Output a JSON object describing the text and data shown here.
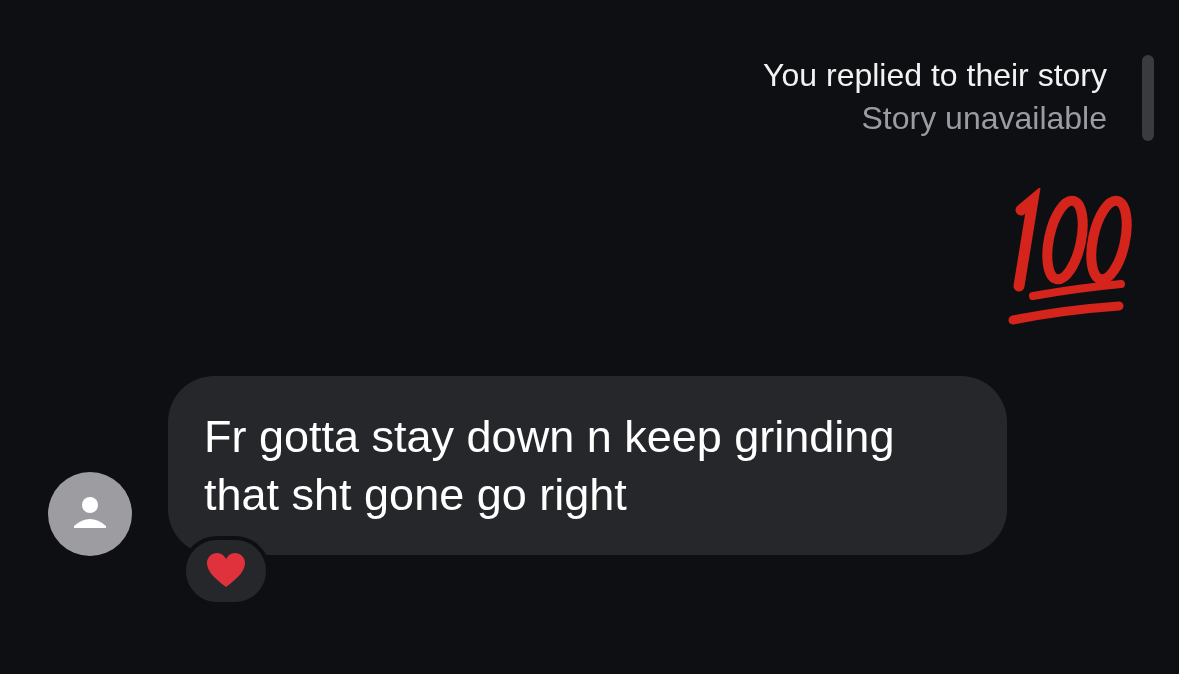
{
  "story_reply": {
    "title": "You replied to their story",
    "status": "Story unavailable"
  },
  "sent_emoji": {
    "kind": "hundred-points"
  },
  "received": {
    "text": "Fr gotta stay down n keep grinding that sht gone go right",
    "reaction": {
      "kind": "heart"
    }
  }
}
